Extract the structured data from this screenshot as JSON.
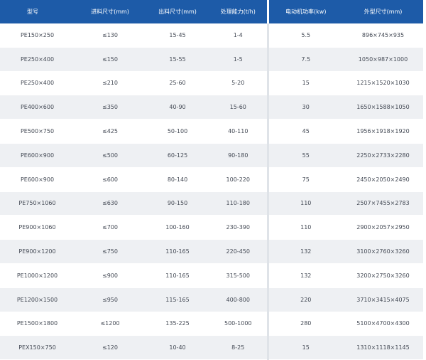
{
  "table": {
    "headers": [
      "型号",
      "进料尺寸(mm)",
      "出料尺寸(mm)",
      "处理能力(t/h)",
      "电动机功率(kw)",
      "外型尺寸(mm)"
    ],
    "rows": [
      [
        "PE150×250",
        "≤130",
        "15-45",
        "1-4",
        "5.5",
        "896×745×935"
      ],
      [
        "PE250×400",
        "≤150",
        "15-55",
        "1-5",
        "7.5",
        "1050×987×1000"
      ],
      [
        "PE250×400",
        "≤210",
        "25-60",
        "5-20",
        "15",
        "1215×1520×1030"
      ],
      [
        "PE400×600",
        "≤350",
        "40-90",
        "15-60",
        "30",
        "1650×1588×1050"
      ],
      [
        "PE500×750",
        "≤425",
        "50-100",
        "40-110",
        "45",
        "1956×1918×1920"
      ],
      [
        "PE600×900",
        "≤500",
        "60-125",
        "90-180",
        "55",
        "2250×2733×2280"
      ],
      [
        "PE600×900",
        "≤600",
        "80-140",
        "100-220",
        "75",
        "2450×2050×2490"
      ],
      [
        "PE750×1060",
        "≤630",
        "90-150",
        "110-180",
        "110",
        "2507×7455×2783"
      ],
      [
        "PE900×1060",
        "≤700",
        "100-160",
        "230-390",
        "110",
        "2900×2057×2950"
      ],
      [
        "PE900×1200",
        "≤750",
        "110-165",
        "220-450",
        "132",
        "3100×2760×3260"
      ],
      [
        "PE1000×1200",
        "≤900",
        "110-165",
        "315-500",
        "132",
        "3200×2750×3260"
      ],
      [
        "PE1200×1500",
        "≤950",
        "115-165",
        "400-800",
        "220",
        "3710×3415×4075"
      ],
      [
        "PE1500×1800",
        "≤1200",
        "135-225",
        "500-1000",
        "280",
        "5100×4700×4300"
      ],
      [
        "PEX150×750",
        "≤120",
        "10-40",
        "8-25",
        "15",
        "1310×1118×1145"
      ]
    ]
  }
}
